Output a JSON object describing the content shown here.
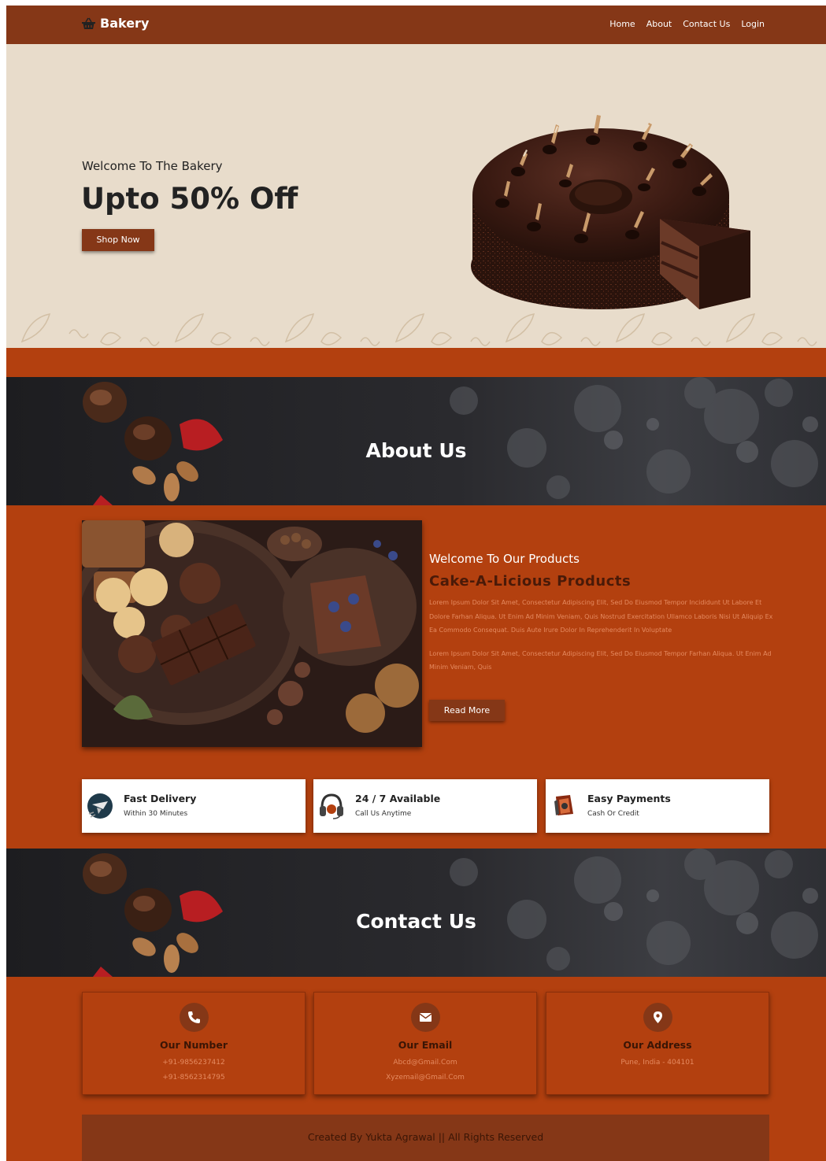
{
  "nav": {
    "brand": "Bakery",
    "brand_icon": "basket-icon",
    "links": [
      "Home",
      "About",
      "Contact Us",
      "Login"
    ]
  },
  "hero": {
    "subtitle": "Welcome To The Bakery",
    "title": "Upto 50% Off",
    "button": "Shop Now"
  },
  "about": {
    "banner_title": "About Us",
    "welcome": "Welcome To Our Products",
    "heading": "Cake-A-Licious Products",
    "para1": "Lorem Ipsum Dolor Sit Amet, Consectetur Adipiscing Elit, Sed Do Eiusmod Tempor Incididunt Ut Labore Et Dolore Farhan Aliqua. Ut Enim Ad Minim Veniam, Quis Nostrud Exercitation Ullamco Laboris Nisi Ut Aliquip Ex Ea Commodo Consequat. Duis Aute Irure Dolor In Reprehenderit In Voluptate",
    "para2": "Lorem Ipsum Dolor Sit Amet, Consectetur Adipiscing Elit, Sed Do Eiusmod Tempor Farhan Aliqua. Ut Enim Ad Minim Veniam, Quis",
    "button": "Read More"
  },
  "features": [
    {
      "title": "Fast Delivery",
      "subtitle": "Within 30 Minutes",
      "icon": "delivery-icon"
    },
    {
      "title": "24 / 7 Available",
      "subtitle": "Call Us Anytime",
      "icon": "headset-icon"
    },
    {
      "title": "Easy Payments",
      "subtitle": "Cash Or Credit",
      "icon": "wallet-icon"
    }
  ],
  "contact": {
    "banner_title": "Contact Us",
    "cards": [
      {
        "title": "Our Number",
        "line1": "+91-9856237412",
        "line2": "+91-8562314795",
        "icon": "phone-icon"
      },
      {
        "title": "Our Email",
        "line1": "Abcd@Gmail.Com",
        "line2": "Xyzemail@Gmail.Com",
        "icon": "envelope-icon"
      },
      {
        "title": "Our Address",
        "line1": "Pune, India - 404101",
        "line2": "",
        "icon": "map-pin-icon"
      }
    ]
  },
  "footer": {
    "text": "Created By Yukta Agrawal || All Rights Reserved"
  },
  "colors": {
    "primary": "#853717",
    "section_bg": "#b3400f",
    "hero_bg": "#e8dccb",
    "banner_bg": "#222225"
  }
}
